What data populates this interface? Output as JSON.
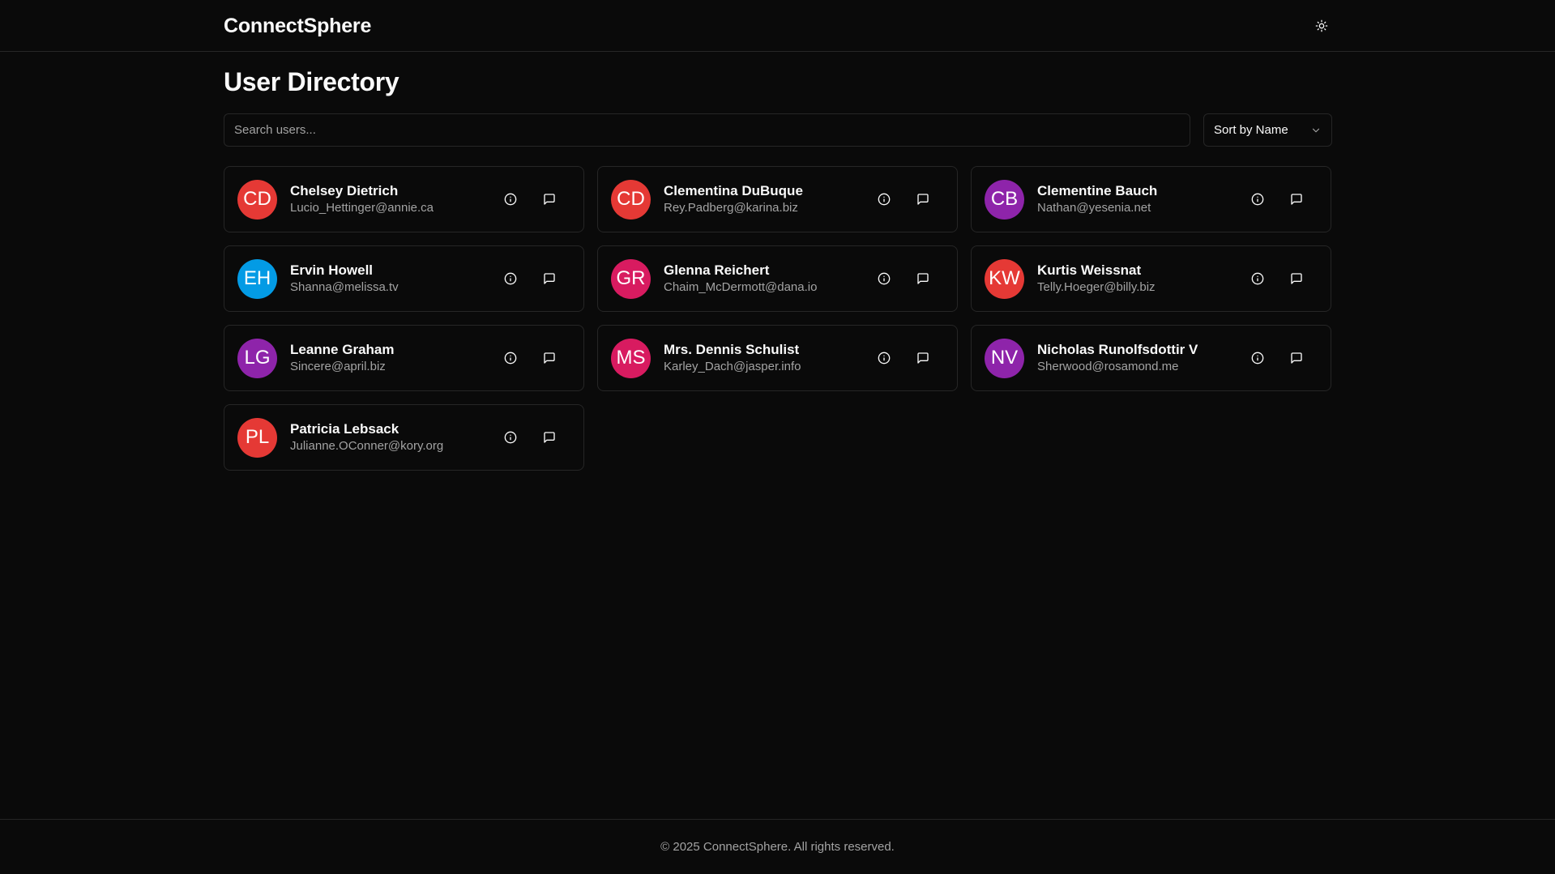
{
  "app": {
    "brand": "ConnectSphere",
    "theme_icon": "sun-icon"
  },
  "page": {
    "title": "User Directory"
  },
  "search": {
    "placeholder": "Search users...",
    "value": ""
  },
  "sort": {
    "label": "Sort by Name",
    "icon": "chevron-down-icon"
  },
  "colors": {
    "background": "#0a0a0a",
    "border": "#262626",
    "text": "#fafafa",
    "muted": "#a3a3a3"
  },
  "users": [
    {
      "initials": "CD",
      "name": "Chelsey Dietrich",
      "email": "Lucio_Hettinger@annie.ca",
      "color": "#e53935"
    },
    {
      "initials": "CD",
      "name": "Clementina DuBuque",
      "email": "Rey.Padberg@karina.biz",
      "color": "#e53935"
    },
    {
      "initials": "CB",
      "name": "Clementine Bauch",
      "email": "Nathan@yesenia.net",
      "color": "#8e24aa"
    },
    {
      "initials": "EH",
      "name": "Ervin Howell",
      "email": "Shanna@melissa.tv",
      "color": "#039be5"
    },
    {
      "initials": "GR",
      "name": "Glenna Reichert",
      "email": "Chaim_McDermott@dana.io",
      "color": "#d81b60"
    },
    {
      "initials": "KW",
      "name": "Kurtis Weissnat",
      "email": "Telly.Hoeger@billy.biz",
      "color": "#e53935"
    },
    {
      "initials": "LG",
      "name": "Leanne Graham",
      "email": "Sincere@april.biz",
      "color": "#8e24aa"
    },
    {
      "initials": "MS",
      "name": "Mrs. Dennis Schulist",
      "email": "Karley_Dach@jasper.info",
      "color": "#d81b60"
    },
    {
      "initials": "NV",
      "name": "Nicholas Runolfsdottir V",
      "email": "Sherwood@rosamond.me",
      "color": "#8e24aa"
    },
    {
      "initials": "PL",
      "name": "Patricia Lebsack",
      "email": "Julianne.OConner@kory.org",
      "color": "#e53935"
    }
  ],
  "card_actions": {
    "info_icon": "info-icon",
    "message_icon": "message-icon"
  },
  "footer": {
    "text": "© 2025 ConnectSphere. All rights reserved."
  }
}
